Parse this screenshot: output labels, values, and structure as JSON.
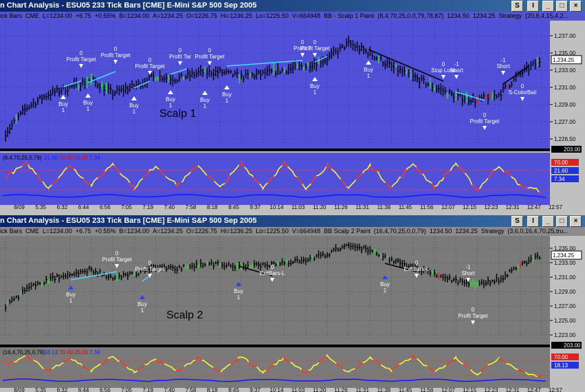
{
  "windows": [
    {
      "title": "n Chart Analysis - ESU05  233 Tick Bars [CME] E-Mini S&P 500 Sep 2005",
      "info_segments": [
        "ick Bars",
        "CME",
        "L=1234.00",
        "+6.75",
        "+0.55%",
        "B=1234.00",
        "A=1234.25",
        "O=1226.75",
        "Hi=1236.25",
        "Lo=1225.50",
        "V=664948",
        "BB - Scalp 1 Paint",
        "(8,4,70,25,0,0,79,78,87)",
        "1234.50",
        "1234.25",
        "Strategy",
        "(20,8,4,15,4,2..."
      ],
      "overlay_label": "Scalp 1",
      "price_ticks": [
        "1,237.00",
        "1,235.00",
        "1,233.00",
        "1,231.00",
        "1,229.00",
        "1,227.00",
        "1,226.50"
      ],
      "last_price": "1,234.25",
      "volume_box": "203.00",
      "indicator_label": "(8,4,70,25,0,79)",
      "indicator_values": [
        "21.60",
        "70.00",
        "25.00",
        "7.34"
      ],
      "indicator_axis_labels": [
        "70.00",
        "21.60",
        "7.34"
      ],
      "signals": [
        {
          "qty": "0",
          "name": "Profit Target"
        },
        {
          "qty": "0",
          "name": "Profit Target"
        },
        {
          "qty": "0",
          "name": "Profit Target"
        },
        {
          "qty": "0",
          "name": "Profit Tar"
        },
        {
          "qty": "0",
          "name": "Profit Target"
        },
        {
          "qty": "0",
          "name": "Profit T"
        },
        {
          "qty": "0",
          "name": "Profit Target"
        },
        {
          "qty": "0",
          "name": "Stop Loss"
        },
        {
          "qty": "-1",
          "name": "Short"
        },
        {
          "qty": "-1",
          "name": "Short"
        },
        {
          "qty": "0",
          "name": "S-ColorBail"
        },
        {
          "qty": "0",
          "name": "Profit Target"
        }
      ],
      "buy_labels": [
        "Buy",
        "Buy",
        "Buy",
        "Buy",
        "Buy",
        "Buy",
        "Buy",
        "Buy"
      ],
      "buy_qty": "1"
    },
    {
      "title": "n Chart Analysis - ESU05  233 Tick Bars [CME] E-Mini S&P 500 Sep 2005",
      "info_segments": [
        "ick Bars",
        "CME",
        "L=1234.00",
        "+6.75",
        "+0.55%",
        "B=1234.00",
        "A=1234.25",
        "O=1226.75",
        "Hi=1236.25",
        "Lo=1225.50",
        "V=664948",
        "BB Scalp 2 Paint",
        "(16,4,70,25,0,0,79)",
        "1234.50",
        "1234.25",
        "Strategy",
        "(3,6,0,16,4,70,25,tru..."
      ],
      "overlay_label": "Scalp 2",
      "price_ticks": [
        "1,235.00",
        "1,233.00",
        "1,231.00",
        "1,229.00",
        "1,227.00",
        "1,225.00",
        "1,223.00"
      ],
      "last_price": "1,234.25",
      "volume_box": "203.00",
      "indicator_label": "(16,4,70,25,0,79)",
      "indicator_values": [
        "18.13",
        "70.00",
        "25.00",
        "7.34"
      ],
      "indicator_axis_labels": [
        "70.00",
        "18.13"
      ],
      "signals": [
        {
          "qty": "0",
          "name": "Profit Target"
        },
        {
          "qty": "0",
          "name": "Profit Target"
        },
        {
          "qty": "0",
          "name": "ExitBars-L"
        },
        {
          "qty": "0",
          "name": "ExitBars-L"
        },
        {
          "qty": "-1",
          "name": "Short"
        },
        {
          "qty": "0",
          "name": "Profit Target"
        }
      ],
      "buy_labels": [
        "Buy",
        "Buy",
        "Buy",
        "Buy"
      ],
      "buy_qty": "1"
    }
  ],
  "chart_data": [
    {
      "type": "line",
      "title": "ESU05 233 Tick Bars [CME] E-Mini S&P 500 Sep 2005 — BB Scalp 1 Paint",
      "x": [
        "8/09",
        "5:35",
        "6:32",
        "6:44",
        "6:56",
        "7:05",
        "7:19",
        "7:40",
        "7:58",
        "8:18",
        "8:45",
        "9:37",
        "10:14",
        "11:03",
        "11:20",
        "11:26",
        "11:31",
        "11:38",
        "11:45",
        "11:56",
        "12:07",
        "12:15",
        "12:23",
        "12:31",
        "12:47",
        "12:57"
      ],
      "series": [
        {
          "values": [
            1227.0,
            1229.5,
            1230.8,
            1231.5,
            1232.2,
            1230.9,
            1231.6,
            1232.6,
            1232.3,
            1232.9,
            1233.0,
            1232.5,
            1232.8,
            1233.2,
            1233.6,
            1234.3,
            1235.8,
            1234.8,
            1233.5,
            1232.5,
            1231.5,
            1230.6,
            1230.2,
            1230.8,
            1232.8,
            1234.2
          ]
        }
      ],
      "ylim": [
        1226.0,
        1237.5
      ],
      "indicator": {
        "x": [
          "8/09",
          "5:35",
          "6:32",
          "6:44",
          "6:56",
          "7:05",
          "7:19",
          "7:40",
          "7:58",
          "8:18",
          "8:45",
          "9:37",
          "10:14",
          "11:03",
          "11:20",
          "11:26",
          "11:31",
          "11:38",
          "11:45",
          "11:56",
          "12:07",
          "12:15",
          "12:23",
          "12:31",
          "12:47",
          "12:57"
        ],
        "values": [
          55,
          85,
          30,
          80,
          35,
          85,
          30,
          80,
          35,
          80,
          30,
          85,
          30,
          85,
          30,
          80,
          30,
          80,
          30,
          85,
          30,
          85,
          25,
          80,
          35,
          21.6
        ],
        "levels": [
          70,
          25
        ],
        "ylim": [
          0,
          100
        ]
      }
    },
    {
      "type": "line",
      "title": "ESU05 233 Tick Bars [CME] E-Mini S&P 500 Sep 2005 — BB Scalp 2 Paint",
      "x": [
        "8/09",
        "5:35",
        "6:32",
        "6:44",
        "6:56",
        "7:05",
        "7:19",
        "7:40",
        "7:58",
        "8:18",
        "8:45",
        "9:37",
        "10:14",
        "11:03",
        "11:20",
        "11:26",
        "11:31",
        "11:38",
        "11:45",
        "11:56",
        "12:07",
        "12:15",
        "12:23",
        "12:31",
        "12:47",
        "12:57"
      ],
      "series": [
        {
          "values": [
            1227.0,
            1229.5,
            1230.8,
            1231.5,
            1232.2,
            1230.9,
            1231.6,
            1232.6,
            1232.3,
            1232.9,
            1233.0,
            1232.5,
            1232.8,
            1233.2,
            1233.6,
            1234.3,
            1235.8,
            1234.8,
            1233.5,
            1232.5,
            1231.5,
            1230.6,
            1230.2,
            1230.8,
            1232.8,
            1234.2
          ]
        }
      ],
      "ylim": [
        1222.5,
        1236.5
      ],
      "indicator": {
        "x": [
          "8/09",
          "5:35",
          "6:32",
          "6:44",
          "6:56",
          "7:05",
          "7:19",
          "7:40",
          "7:58",
          "8:18",
          "8:45",
          "9:37",
          "10:14",
          "11:03",
          "11:20",
          "11:26",
          "11:31",
          "11:38",
          "11:45",
          "11:56",
          "12:07",
          "12:15",
          "12:23",
          "12:31",
          "12:47",
          "12:57"
        ],
        "values": [
          60,
          85,
          40,
          80,
          40,
          85,
          35,
          75,
          40,
          80,
          35,
          85,
          35,
          80,
          35,
          85,
          35,
          80,
          40,
          85,
          35,
          80,
          30,
          80,
          40,
          18.13
        ],
        "levels": [
          70,
          25
        ],
        "ylim": [
          0,
          100
        ]
      }
    }
  ],
  "colors": {
    "panel1_bg": "#5050d8",
    "panel2_bg": "#7a7a7a",
    "bars": "#000000",
    "paint_green": "#33dd33",
    "paint_red": "#dd2222",
    "trade_line": "#44ddff",
    "osc_yellow": "#ffff33",
    "osc_red": "#ff2222",
    "osc_blue": "#1515ff"
  }
}
